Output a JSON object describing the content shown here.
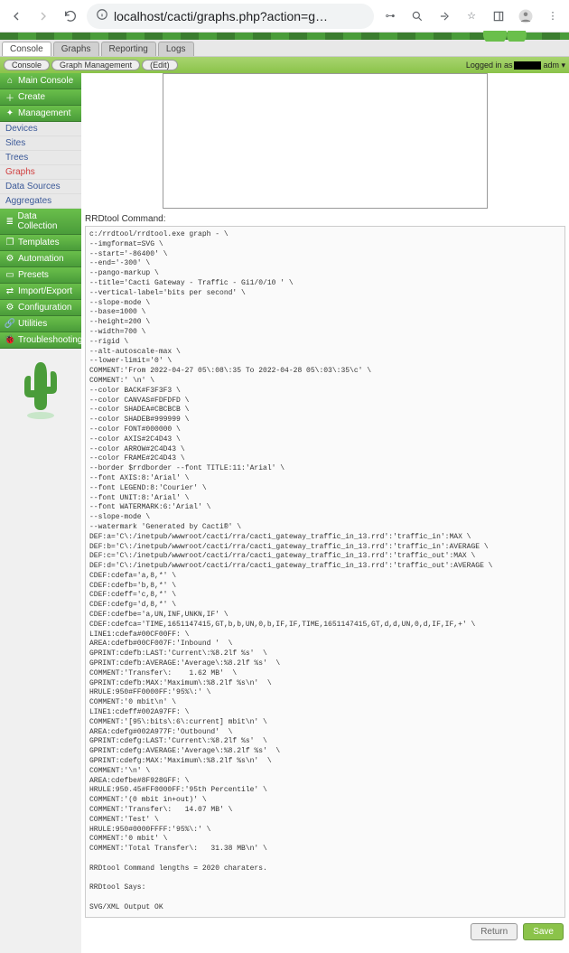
{
  "browser": {
    "url_display": "localhost/cacti/graphs.php?action=g…",
    "url_host": "localhost"
  },
  "tabs": [
    "Console",
    "Graphs",
    "Reporting",
    "Logs"
  ],
  "breadcrumbs": [
    "Console",
    "Graph Management",
    "(Edit)"
  ],
  "login": {
    "prefix": "Logged in as",
    "suffix": "adm ▾"
  },
  "sidebar": {
    "main_console": "Main Console",
    "create": "Create",
    "management": "Management",
    "mgmt_items": [
      "Devices",
      "Sites",
      "Trees",
      "Graphs",
      "Data Sources",
      "Aggregates"
    ],
    "data_collection": "Data Collection",
    "templates": "Templates",
    "automation": "Automation",
    "presets": "Presets",
    "import_export": "Import/Export",
    "configuration": "Configuration",
    "utilities": "Utilities",
    "troubleshooting": "Troubleshooting"
  },
  "content": {
    "rrd_label": "RRDtool Command:",
    "rrd_command": "c:/rrdtool/rrdtool.exe graph - \\\n--imgformat=SVG \\\n--start='-86400' \\\n--end='-300' \\\n--pango-markup \\\n--title='Cacti Gateway - Traffic - Gi1/0/10 ' \\\n--vertical-label='bits per second' \\\n--slope-mode \\\n--base=1000 \\\n--height=200 \\\n--width=700 \\\n--rigid \\\n--alt-autoscale-max \\\n--lower-limit='0' \\\nCOMMENT:'From 2022-04-27 05\\:08\\:35 To 2022-04-28 05\\:03\\:35\\c' \\\nCOMMENT:' \\n' \\\n--color BACK#F3F3F3 \\\n--color CANVAS#FDFDFD \\\n--color SHADEA#CBCBCB \\\n--color SHADEB#999999 \\\n--color FONT#000000 \\\n--color AXIS#2C4D43 \\\n--color ARROW#2C4D43 \\\n--color FRAME#2C4D43 \\\n--border $rrdborder --font TITLE:11:'Arial' \\\n--font AXIS:8:'Arial' \\\n--font LEGEND:8:'Courier' \\\n--font UNIT:8:'Arial' \\\n--font WATERMARK:6:'Arial' \\\n--slope-mode \\\n--watermark 'Generated by Cacti®' \\\nDEF:a='C\\:/inetpub/wwwroot/cacti/rra/cacti_gateway_traffic_in_13.rrd':'traffic_in':MAX \\\nDEF:b='C\\:/inetpub/wwwroot/cacti/rra/cacti_gateway_traffic_in_13.rrd':'traffic_in':AVERAGE \\\nDEF:c='C\\:/inetpub/wwwroot/cacti/rra/cacti_gateway_traffic_in_13.rrd':'traffic_out':MAX \\\nDEF:d='C\\:/inetpub/wwwroot/cacti/rra/cacti_gateway_traffic_in_13.rrd':'traffic_out':AVERAGE \\\nCDEF:cdefa='a,8,*' \\\nCDEF:cdefb='b,8,*' \\\nCDEF:cdeff='c,8,*' \\\nCDEF:cdefg='d,8,*' \\\nCDEF:cdefbe='a,UN,INF,UNKN,IF' \\\nCDEF:cdefca='TIME,1651147415,GT,b,b,UN,0,b,IF,IF,TIME,1651147415,GT,d,d,UN,0,d,IF,IF,+' \\\nLINE1:cdefa#00CF00FF: \\\nAREA:cdefb#00CF007F:'Inbound '  \\\nGPRINT:cdefb:LAST:'Current\\:%8.2lf %s'  \\\nGPRINT:cdefb:AVERAGE:'Average\\:%8.2lf %s'  \\\nCOMMENT:'Transfer\\:    1.62 MB'  \\\nGPRINT:cdefb:MAX:'Maximum\\:%8.2lf %s\\n'  \\\nHRULE:950#FF0000FF:'95%\\:' \\\nCOMMENT:'0 mbit\\n' \\\nLINE1:cdeff#002A97FF: \\\nCOMMENT:'[95\\:bits\\:6\\:current] mbit\\n' \\\nAREA:cdefg#002A977F:'Outbound'  \\\nGPRINT:cdefg:LAST:'Current\\:%8.2lf %s'  \\\nGPRINT:cdefg:AVERAGE:'Average\\:%8.2lf %s'  \\\nGPRINT:cdefg:MAX:'Maximum\\:%8.2lf %s\\n'  \\\nCOMMENT:'\\n' \\\nAREA:cdefbe#8F928GFF: \\\nHRULE:950.45#FF0000FF:'95th Percentile' \\\nCOMMENT:'(0 mbit in+out)' \\\nCOMMENT:'Transfer\\:   14.07 MB' \\\nCOMMENT:'Test' \\\nHRULE:950#0000FFFF:'95%\\:' \\\nCOMMENT:'0 mbit' \\\nCOMMENT:'Total Transfer\\:   31.38 MB\\n' \\\n\nRRDtool Command lengths = 2020 charaters.\n\nRRDtool Says:\n\nSVG/XML Output OK",
    "return_btn": "Return",
    "save_btn": "Save"
  }
}
